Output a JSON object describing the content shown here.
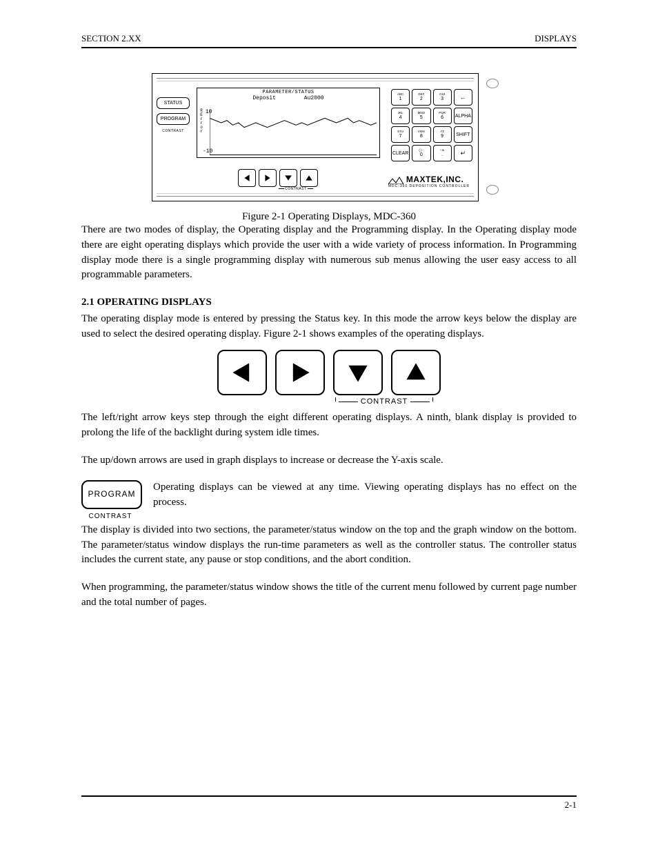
{
  "header": {
    "left": "SECTION 2.XX",
    "right": "DISPLAYS"
  },
  "figure1": {
    "caption": "Figure 2-1  Operating Displays, MDC-360",
    "panel": {
      "left_buttons": {
        "status": "STATUS",
        "program": "PROGRAM",
        "contrast_label": "CONTRAST"
      },
      "screen": {
        "title": "PARAMETER/STATUS",
        "subtitle_left": "Deposit",
        "subtitle_right": "Au2000",
        "y_axis_letters": [
          "R",
          "E",
          "r",
          "r",
          "o",
          "r"
        ],
        "y_top": "10",
        "y_bottom": "-10"
      },
      "keypad": [
        [
          {
            "t": "ABC",
            "b": "1"
          },
          {
            "t": "DEF",
            "b": "2"
          },
          {
            "t": "GHI",
            "b": "3"
          },
          {
            "t": "",
            "b": "←",
            "sym": true
          }
        ],
        [
          {
            "t": "JKL",
            "b": "4"
          },
          {
            "t": "MNO",
            "b": "5"
          },
          {
            "t": "PQR",
            "b": "6"
          },
          {
            "t": "",
            "b": "ALPHA"
          }
        ],
        [
          {
            "t": "STU",
            "b": "7"
          },
          {
            "t": "VWX",
            "b": "8"
          },
          {
            "t": "YZ",
            "b": "9"
          },
          {
            "t": "",
            "b": "SHIFT"
          }
        ],
        [
          {
            "t": "",
            "b": "CLEAR"
          },
          {
            "t": "( ) -",
            "b": "0"
          },
          {
            "t": "! &",
            "b": "."
          },
          {
            "t": "",
            "b": "↵",
            "sym": true
          }
        ]
      ],
      "contrast_small": "CONTRAST",
      "brand": {
        "name": "MAXTEK,INC.",
        "sub": "MDC-360 DEPOSITION CONTROLLER"
      }
    }
  },
  "text": {
    "p1": "There are two modes of display, the Operating display and the Programming display. In the Operating display mode there are eight operating displays which provide the user with a wide variety of process information. In Programming display mode there is a single programming display with numerous sub menus allowing the user easy access to all programmable parameters.",
    "h2_1": "2.1  OPERATING DISPLAYS",
    "p2": "The operating display mode is entered by pressing the Status key. In this mode the arrow keys below the display are used to select the desired operating display. Figure 2-1 shows examples of the operating displays.",
    "arrow_caption": "CONTRAST",
    "p3": "The left/right arrow keys step through the eight different operating displays. A ninth, blank display is provided to prolong the life of the backlight during system idle times.",
    "p4": "The up/down arrows are used in graph displays to increase or decrease the Y-axis scale.",
    "p5": "Operating displays can be viewed at any time. Viewing operating displays has no effect on the process.",
    "p6": "The display is divided into two sections, the parameter/status window on the top and the graph window on the bottom. The parameter/status window displays the run-time parameters as well as the controller status. The controller status includes the current state, any pause or stop conditions, and the abort condition.",
    "program_button": "PROGRAM",
    "program_sub": "CONTRAST",
    "p7": "When programming, the parameter/status window shows the title of the current menu followed by current page number and the total number of pages."
  },
  "chart_data": {
    "type": "line",
    "title": "PARAMETER/STATUS — Deposit Au2000",
    "ylabel": "R Error",
    "ylim": [
      -10,
      10
    ],
    "x": [
      0,
      1,
      2,
      3,
      4,
      5,
      6,
      7,
      8,
      9,
      10,
      11,
      12,
      13,
      14,
      15,
      16,
      17,
      18,
      19,
      20,
      21,
      22,
      23,
      24,
      25,
      26,
      27,
      28,
      29
    ],
    "values": [
      6,
      5,
      4,
      5,
      3,
      4,
      2,
      3,
      4,
      3,
      2,
      3,
      4,
      5,
      4,
      3,
      4,
      3,
      4,
      5,
      6,
      5,
      4,
      5,
      6,
      4,
      5,
      4,
      3,
      4
    ]
  },
  "footer": {
    "text": "2-1"
  }
}
